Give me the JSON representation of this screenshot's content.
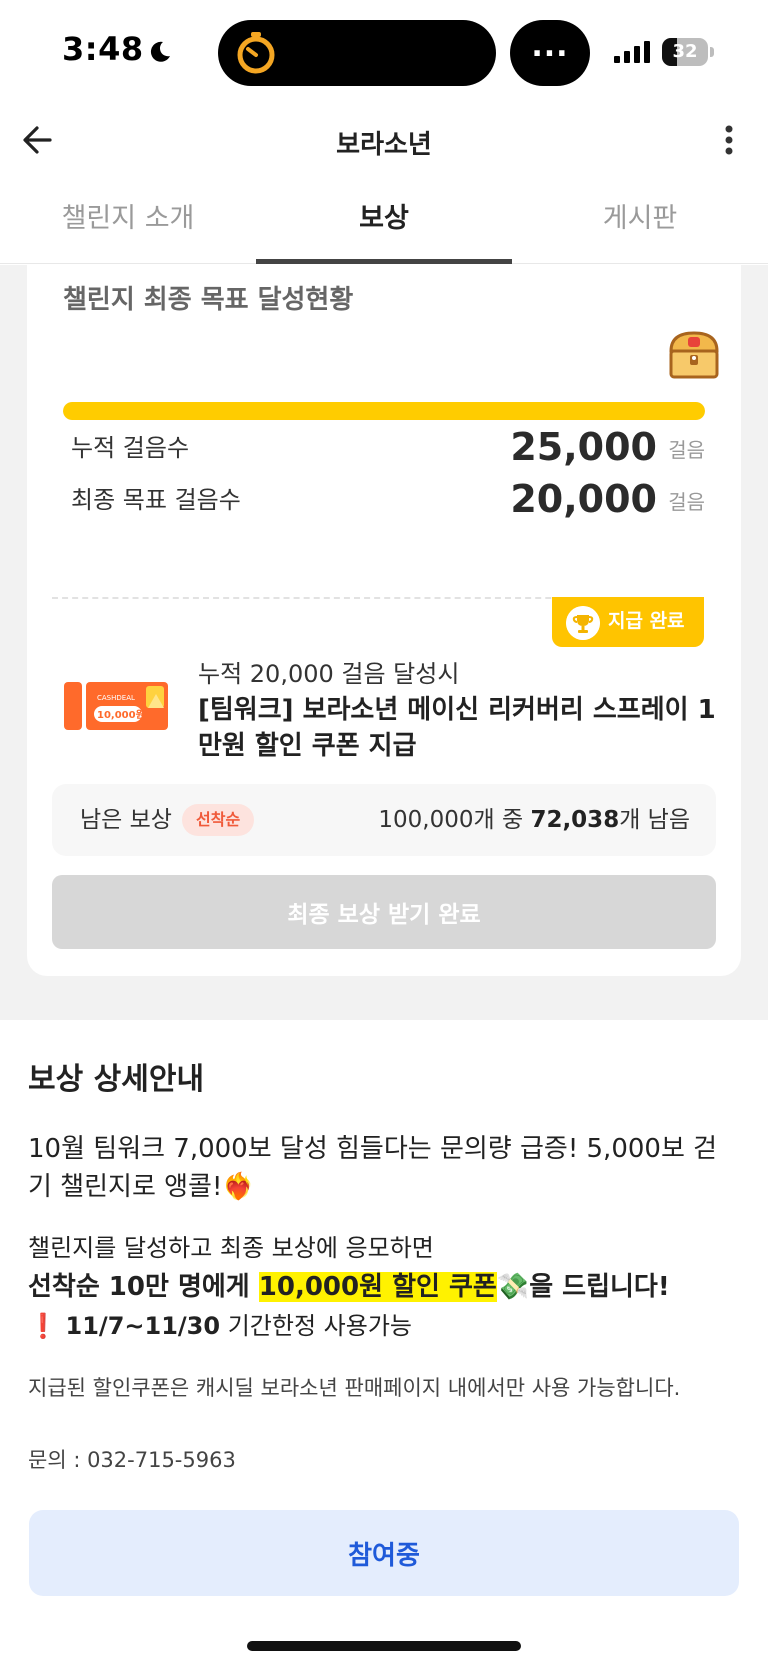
{
  "status_bar": {
    "time": "3:48",
    "pill_text": "...",
    "battery_level": "32",
    "battery_fraction": 0.32
  },
  "header": {
    "title": "보라소년"
  },
  "tabs": [
    {
      "label": "챌린지 소개",
      "active": false
    },
    {
      "label": "보상",
      "active": true
    },
    {
      "label": "게시판",
      "active": false
    }
  ],
  "goal_card": {
    "title": "챌린지 최종 목표 달성현황",
    "progress_fraction": 1.0,
    "stats": [
      {
        "label": "누적 걸음수",
        "value": "25,000",
        "unit": "걸음"
      },
      {
        "label": "최종 목표 걸음수",
        "value": "20,000",
        "unit": "걸음"
      }
    ],
    "badge_label": "지급 완료",
    "reward_condition": "누적 20,000 걸음 달성시",
    "reward_name": "[팀워크] 보라소년 메이신 리커버리 스프레이 1만원 할인 쿠폰 지급",
    "coupon_brand": "CASHDEAL",
    "coupon_amount": "10,000원",
    "remain_label": "남은 보상",
    "remain_badge": "선착순",
    "remain_prefix": "100,000개 중 ",
    "remain_value": "72,038",
    "remain_suffix": "개 남음",
    "final_button": "최종 보상 받기 완료"
  },
  "detail": {
    "title": "보상 상세안내",
    "p1": "10월 팀워크 7,000보 달성 힘들다는 문의량 급증! 5,000보 걷기 챌린지로 앵콜!❤️‍🔥",
    "p2": "챌린지를 달성하고 최종 보상에 응모하면",
    "p3_prefix": "선착순 10만 명에게 ",
    "p3_highlight": "10,000원 할인 쿠폰",
    "p3_emoji": "💸",
    "p3_suffix": "을 드립니다!",
    "p4_mark": "❗",
    "p4_dates": "11/7~11/30",
    "p4_suffix": " 기간한정 사용가능",
    "note": "지급된 할인쿠폰은 캐시딜 보라소년 판매페이지 내에서만 사용 가능합니다.",
    "contact": "문의 : 032-715-5963"
  },
  "join_button": "참여중",
  "colors": {
    "accent_yellow": "#ffcc00",
    "badge_red": "#f05a3a",
    "button_blue": "#1f5ad9"
  }
}
